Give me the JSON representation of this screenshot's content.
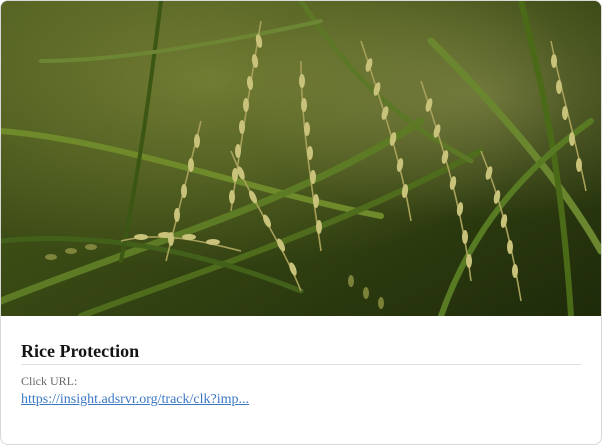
{
  "card": {
    "image_subject": "rice-plants-photo",
    "title": "Rice Protection",
    "url_label": "Click URL:",
    "url_text": "https://insight.adsrvr.org/track/clk?imp..."
  },
  "colors": {
    "title": "#141414",
    "label": "#666666",
    "link": "#3b78c4",
    "border": "#d8d8d8"
  }
}
